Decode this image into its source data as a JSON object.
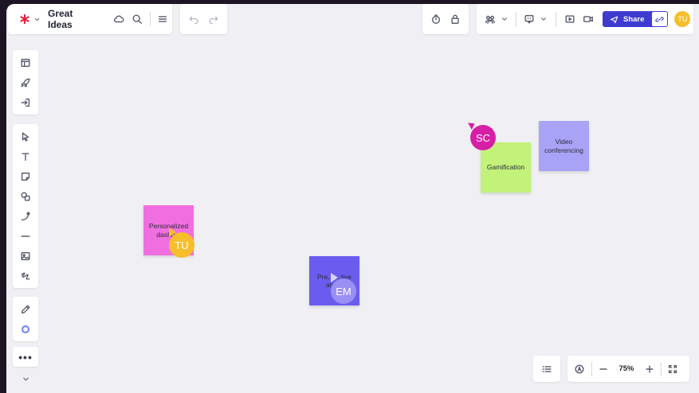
{
  "header": {
    "title": "Great Ideas",
    "share_label": "Share",
    "user_initials": "TU"
  },
  "zoom": {
    "level": "75%"
  },
  "notes": [
    {
      "text": "Personalized dashb...",
      "color": "#f06fe0"
    },
    {
      "text": "Pre... ...tive ana...",
      "color": "#6b5cf0"
    },
    {
      "text": "Gamification",
      "color": "#c2f27a"
    },
    {
      "text": "Video conferencing",
      "color": "#a9a3f7"
    }
  ],
  "collaborators": [
    {
      "initials": "SC",
      "color": "#d61fa5"
    },
    {
      "initials": "TU",
      "color": "#f7be2c"
    },
    {
      "initials": "EM",
      "color": "#9a8ff2"
    }
  ],
  "colors": {
    "brand": "#e0223a",
    "share": "#3f3bd1",
    "canvas": "#f0f0f4"
  }
}
